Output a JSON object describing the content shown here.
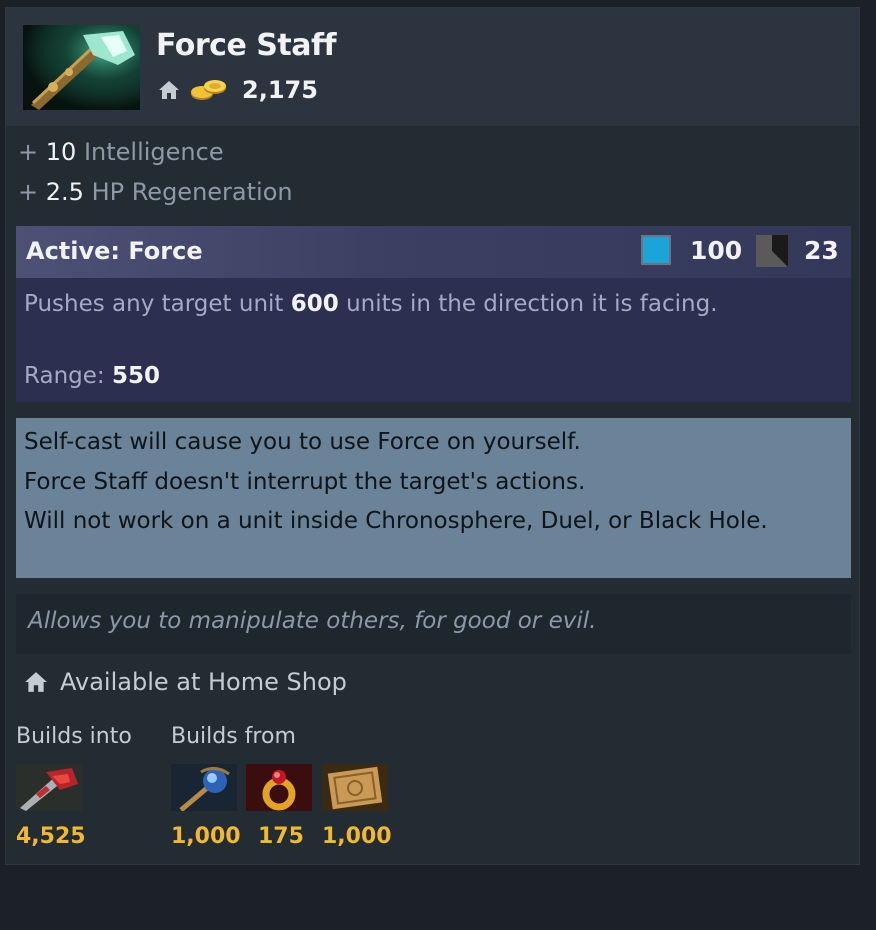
{
  "item": {
    "name": "Force Staff",
    "cost": "2,175"
  },
  "stats": [
    {
      "prefix": "+",
      "value": "10",
      "label": "Intelligence"
    },
    {
      "prefix": "+",
      "value": "2.5",
      "label": "HP Regeneration"
    }
  ],
  "active": {
    "title": "Active: Force",
    "mana_cost": "100",
    "cooldown": "23",
    "desc_before": "Pushes any target unit ",
    "desc_value": "600",
    "desc_after": " units in the direction it is facing.",
    "range_label": "Range: ",
    "range_value": "550"
  },
  "notes": [
    "Self-cast will cause you to use Force on yourself.",
    "Force Staff doesn't interrupt the target's actions.",
    "Will not work on a unit inside Chronosphere, Duel, or Black Hole."
  ],
  "lore": "Allows you to manipulate others, for good or evil.",
  "availability": "Available at Home Shop",
  "builds_into": {
    "label": "Builds into",
    "items": [
      {
        "icon": "hurricane-pike-icon",
        "price": "4,525"
      }
    ]
  },
  "builds_from": {
    "label": "Builds from",
    "items": [
      {
        "icon": "staff-of-wizardry-icon",
        "price": "1,000"
      },
      {
        "icon": "ring-of-regen-icon",
        "price": "175"
      },
      {
        "icon": "recipe-scroll-icon",
        "price": "1,000"
      }
    ]
  },
  "colors": {
    "gold": "#f1b92b",
    "mana": "#1ba4d8",
    "notes_bg": "#6a8399",
    "active_bg": "#2c2f4f"
  }
}
